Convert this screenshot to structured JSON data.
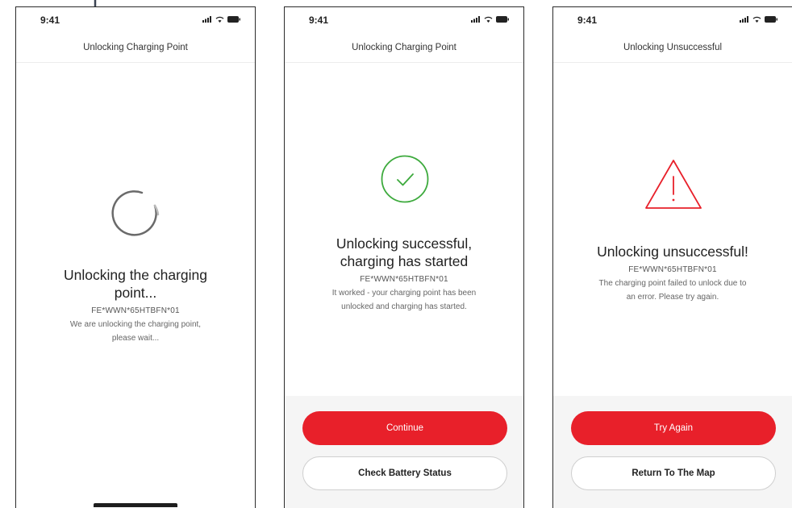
{
  "colors": {
    "accent_red": "#e8202a",
    "success_green": "#3daa3d",
    "error_red": "#e8202a",
    "annotation_arrow": "#3b4352"
  },
  "screens": [
    {
      "status_time": "9:41",
      "nav_title": "Unlocking Charging Point",
      "icon": "loading-spinner-icon",
      "headline_lines": [
        "Unlocking the charging",
        "point..."
      ],
      "code": "FE*WWN*65HTBFN*01",
      "description_lines": [
        "We are unlocking the charging point,",
        "please wait..."
      ]
    },
    {
      "status_time": "9:41",
      "nav_title": "Unlocking Charging Point",
      "icon": "success-check-icon",
      "headline_lines": [
        "Unlocking successful,",
        "charging has started"
      ],
      "code": "FE*WWN*65HTBFN*01",
      "description_lines": [
        "It worked - your charging point has been",
        "unlocked and charging has started."
      ],
      "primary_button": "Continue",
      "secondary_button": "Check Battery Status"
    },
    {
      "status_time": "9:41",
      "nav_title": "Unlocking Unsuccessful",
      "icon": "warning-triangle-icon",
      "headline_lines": [
        "Unlocking unsuccessful!"
      ],
      "code": "FE*WWN*65HTBFN*01",
      "description_lines": [
        "The charging point failed to unlock due to",
        "an error. Please try again."
      ],
      "primary_button": "Try Again",
      "secondary_button": "Return To The Map"
    }
  ]
}
